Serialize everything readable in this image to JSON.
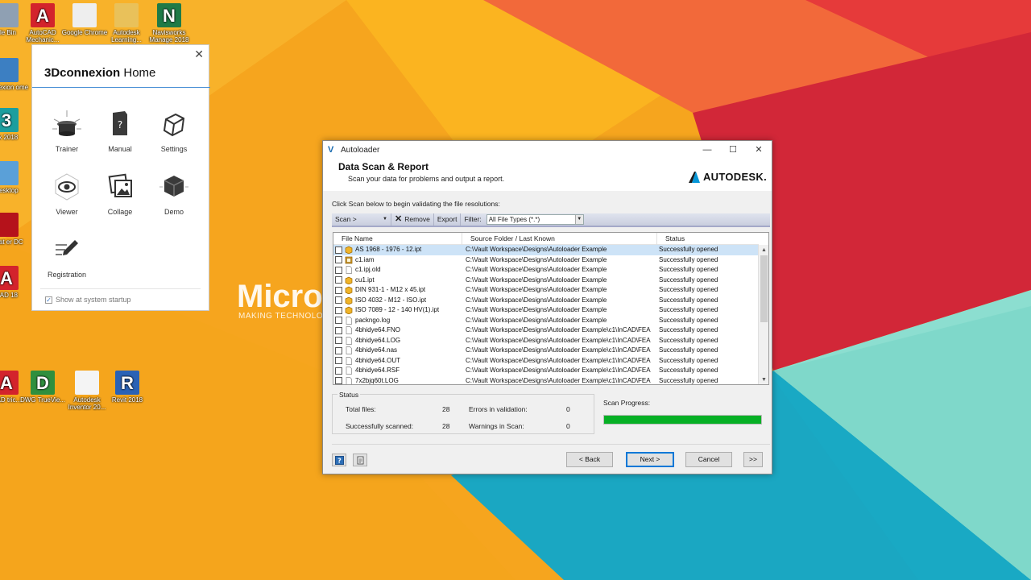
{
  "desktop": {
    "icons": [
      {
        "id": "recycle-bin",
        "label": "cle Bin",
        "color": "#8fa0b3",
        "glyph": ""
      },
      {
        "id": "autocad-mech",
        "label": "AutoCAD Mechanic...",
        "color": "#d3232c",
        "glyph": "A"
      },
      {
        "id": "chrome",
        "label": "Google Chrome",
        "color": "#eeeeee",
        "glyph": ""
      },
      {
        "id": "autodesk-learning",
        "label": "Autodesk Learning...",
        "color": "#e9c15a",
        "glyph": ""
      },
      {
        "id": "navisworks",
        "label": "Navisworks Manage 2018",
        "color": "#1f7a47",
        "glyph": "N"
      },
      {
        "id": "connexion",
        "label": "connexion ome",
        "color": "#3c7fc2",
        "glyph": ""
      },
      {
        "id": "max",
        "label": "ax 2018",
        "color": "#1d9e9e",
        "glyph": "3"
      },
      {
        "id": "desktop",
        "label": "Desktop",
        "color": "#5aa0d8",
        "glyph": ""
      },
      {
        "id": "acrobat",
        "label": "robat er DC",
        "color": "#b5121b",
        "glyph": ""
      },
      {
        "id": "autocad-2",
        "label": "CAD 18",
        "color": "#d3232c",
        "glyph": "A"
      },
      {
        "id": "autocad-3",
        "label": "CAD tric...",
        "color": "#d3232c",
        "glyph": "A"
      },
      {
        "id": "dwg-trueview",
        "label": "DWG TrueVie...",
        "color": "#2f8f3e",
        "glyph": "D"
      },
      {
        "id": "inventor",
        "label": "Autodesk Inventor 20...",
        "color": "#f4f4f4",
        "glyph": ""
      },
      {
        "id": "revit",
        "label": "Revit 2018",
        "color": "#2a62b5",
        "glyph": "R"
      }
    ],
    "brand_text": "Micro",
    "brand_tagline": "MAKING TECHNOLOG"
  },
  "home": {
    "brand": "3Dconnexion",
    "title_suffix": "Home",
    "close": "✕",
    "items": [
      {
        "label": "Trainer"
      },
      {
        "label": "Manual"
      },
      {
        "label": "Settings"
      },
      {
        "label": "Viewer"
      },
      {
        "label": "Collage"
      },
      {
        "label": "Demo"
      },
      {
        "label": "Registration"
      }
    ],
    "startup_label": "Show at system startup",
    "startup_check": "✓"
  },
  "window": {
    "title": "Autoloader",
    "controls": {
      "minimize": "—",
      "maximize": "☐",
      "close": "✕"
    },
    "header_title": "Data Scan & Report",
    "header_subtitle": "Scan your data for problems and output a report.",
    "brand": "AUTODESK.",
    "instruction": "Click Scan below to begin validating the file resolutions:",
    "toolbar": {
      "scan": "Scan >",
      "remove": "Remove",
      "export": "Export",
      "filter_label": "Filter:",
      "filter_value": "All File Types (*.*)"
    },
    "columns": [
      "File Name",
      "Source Folder / Last Known",
      "Status"
    ],
    "rows": [
      {
        "name": "AS 1968 - 1976 - 12.ipt",
        "folder": "C:\\Vault Workspace\\Designs\\Autoloader Example",
        "status": "Successfully opened",
        "icon": "part",
        "selected": true
      },
      {
        "name": "c1.iam",
        "folder": "C:\\Vault Workspace\\Designs\\Autoloader Example",
        "status": "Successfully opened",
        "icon": "assembly",
        "selected": false
      },
      {
        "name": "c1.ipj.old",
        "folder": "C:\\Vault Workspace\\Designs\\Autoloader Example",
        "status": "Successfully opened",
        "icon": "doc",
        "selected": false
      },
      {
        "name": "cu1.ipt",
        "folder": "C:\\Vault Workspace\\Designs\\Autoloader Example",
        "status": "Successfully opened",
        "icon": "part",
        "selected": false
      },
      {
        "name": "DIN 931-1 - M12 x 45.ipt",
        "folder": "C:\\Vault Workspace\\Designs\\Autoloader Example",
        "status": "Successfully opened",
        "icon": "part",
        "selected": false
      },
      {
        "name": "ISO 4032 - M12 - ISO.ipt",
        "folder": "C:\\Vault Workspace\\Designs\\Autoloader Example",
        "status": "Successfully opened",
        "icon": "part",
        "selected": false
      },
      {
        "name": "ISO 7089 - 12 - 140 HV(1).ipt",
        "folder": "C:\\Vault Workspace\\Designs\\Autoloader Example",
        "status": "Successfully opened",
        "icon": "part",
        "selected": false
      },
      {
        "name": "packngo.log",
        "folder": "C:\\Vault Workspace\\Designs\\Autoloader Example",
        "status": "Successfully opened",
        "icon": "doc",
        "selected": false
      },
      {
        "name": "4bhidye64.FNO",
        "folder": "C:\\Vault Workspace\\Designs\\Autoloader Example\\c1\\InCAD\\FEA",
        "status": "Successfully opened",
        "icon": "doc",
        "selected": false
      },
      {
        "name": "4bhidye64.LOG",
        "folder": "C:\\Vault Workspace\\Designs\\Autoloader Example\\c1\\InCAD\\FEA",
        "status": "Successfully opened",
        "icon": "doc",
        "selected": false
      },
      {
        "name": "4bhidye64.nas",
        "folder": "C:\\Vault Workspace\\Designs\\Autoloader Example\\c1\\InCAD\\FEA",
        "status": "Successfully opened",
        "icon": "doc",
        "selected": false
      },
      {
        "name": "4bhidye64.OUT",
        "folder": "C:\\Vault Workspace\\Designs\\Autoloader Example\\c1\\InCAD\\FEA",
        "status": "Successfully opened",
        "icon": "doc",
        "selected": false
      },
      {
        "name": "4bhidye64.RSF",
        "folder": "C:\\Vault Workspace\\Designs\\Autoloader Example\\c1\\InCAD\\FEA",
        "status": "Successfully opened",
        "icon": "doc",
        "selected": false
      },
      {
        "name": "7x2bjq60t.LOG",
        "folder": "C:\\Vault Workspace\\Designs\\Autoloader Example\\c1\\InCAD\\FEA",
        "status": "Successfully opened",
        "icon": "doc",
        "selected": false
      }
    ],
    "status": {
      "legend": "Status",
      "total_label": "Total files:",
      "total_value": "28",
      "scanned_label": "Successfully scanned:",
      "scanned_value": "28",
      "errors_label": "Errors in validation:",
      "errors_value": "0",
      "warnings_label": "Warnings in Scan:",
      "warnings_value": "0"
    },
    "progress_label": "Scan Progress:",
    "progress_fraction": 1.0,
    "progress_color": "#06b025",
    "buttons": {
      "back": "< Back",
      "next": "Next >",
      "cancel": "Cancel",
      "more": ">>"
    }
  }
}
